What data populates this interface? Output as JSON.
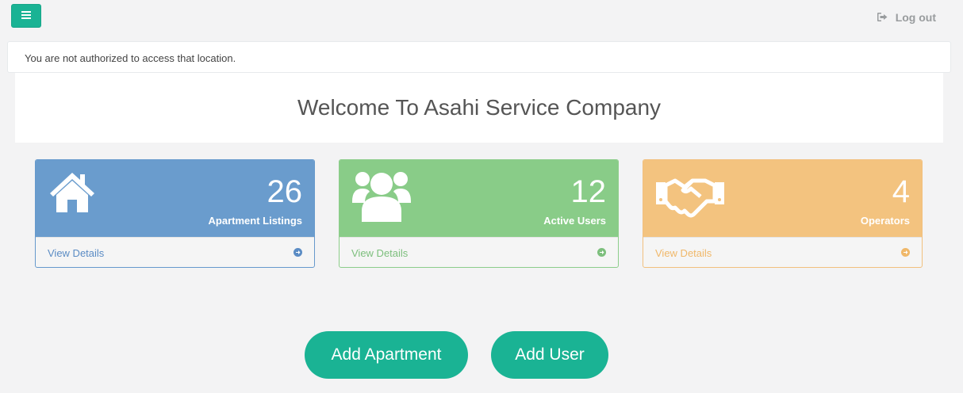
{
  "header": {
    "menu_icon": "hamburger-icon",
    "logout_label": "Log out",
    "logout_icon": "sign-out-icon"
  },
  "alert": {
    "message": "You are not authorized to access that location."
  },
  "welcome": {
    "title": "Welcome To Asahi Service Company"
  },
  "cards": [
    {
      "icon": "home-icon",
      "count": "26",
      "label": "Apartment Listings",
      "link": "View Details",
      "arrow_icon": "arrow-circle-right-icon",
      "color": "#6a9ccd"
    },
    {
      "icon": "users-icon",
      "count": "12",
      "label": "Active Users",
      "link": "View Details",
      "arrow_icon": "arrow-circle-right-icon",
      "color": "#89cc88"
    },
    {
      "icon": "handshake-icon",
      "count": "4",
      "label": "Operators",
      "link": "View Details",
      "arrow_icon": "arrow-circle-right-icon",
      "color": "#f3c37f"
    }
  ],
  "actions": {
    "add_apartment": "Add Apartment",
    "add_user": "Add User"
  },
  "colors": {
    "accent": "#1ab394",
    "background": "#f3f3f4"
  }
}
